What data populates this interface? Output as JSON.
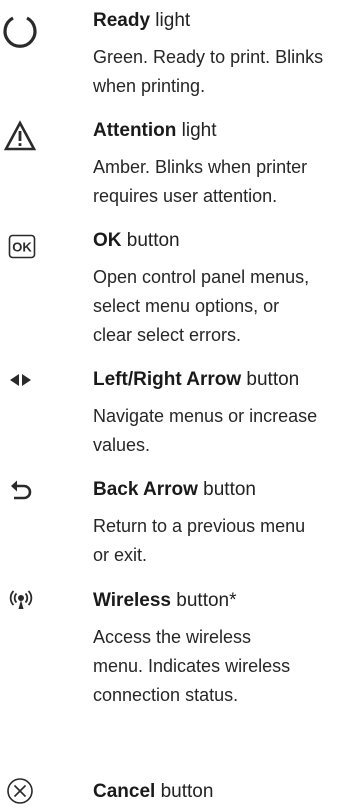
{
  "entries": [
    {
      "icon": "ready-light-icon",
      "title_bold": "Ready",
      "title_rest": " light",
      "desc_lines": [
        "Green. Ready to print. Blinks",
        "when printing."
      ]
    },
    {
      "icon": "attention-light-icon",
      "title_bold": "Attention",
      "title_rest": " light",
      "desc_lines": [
        "Amber. Blinks when printer",
        "requires user attention."
      ]
    },
    {
      "icon": "ok-button-icon",
      "icon_text": "OK",
      "title_bold": "OK",
      "title_rest": " button",
      "desc_lines": [
        "Open control panel menus,",
        "select menu options, or",
        "clear select errors."
      ]
    },
    {
      "icon": "left-right-arrow-icon",
      "title_bold": "Left/Right Arrow",
      "title_rest": " button",
      "desc_lines": [
        "Navigate menus or increase",
        "values."
      ]
    },
    {
      "icon": "back-arrow-icon",
      "title_bold": "Back Arrow",
      "title_rest": " button",
      "desc_lines": [
        "Return to a previous menu",
        "or exit."
      ]
    },
    {
      "icon": "wireless-icon",
      "title_bold": "Wireless",
      "title_rest": " button*",
      "desc_lines": [
        "Access the wireless",
        "menu. Indicates wireless",
        "connection status."
      ]
    },
    {
      "icon": "cancel-icon",
      "title_bold": "Cancel",
      "title_rest": " button",
      "desc_lines": []
    }
  ],
  "colors": {
    "text": "#222222",
    "icon": "#2a2a2a"
  }
}
